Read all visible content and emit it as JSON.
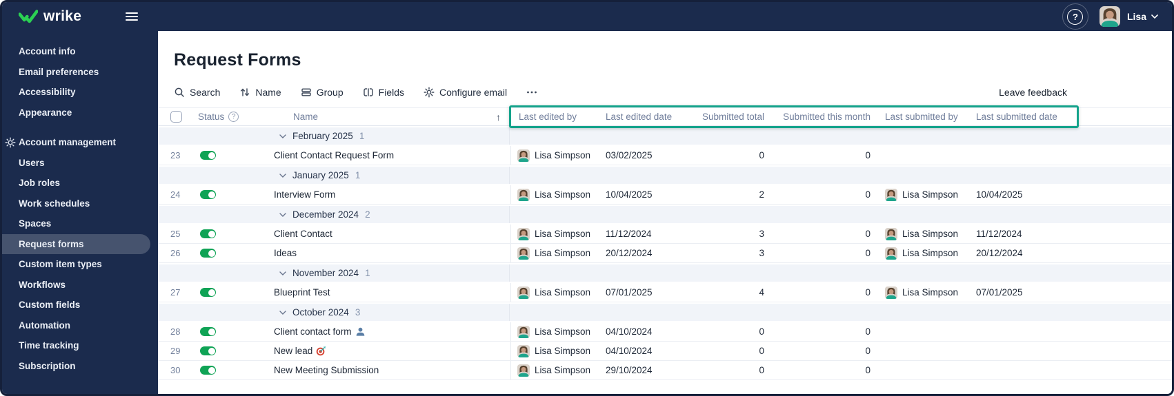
{
  "colors": {
    "navy": "#1B2B4D",
    "sidebar_selected": "#46536E",
    "toggle_green": "#0FA355",
    "annotation_green": "#14A38B",
    "group_row_bg": "#F1F4F9"
  },
  "topbar": {
    "logo_text": "wrike",
    "help_glyph": "?",
    "user_name": "Lisa"
  },
  "sidebar": {
    "items": [
      {
        "label": "Account info"
      },
      {
        "label": "Email preferences"
      },
      {
        "label": "Accessibility"
      },
      {
        "label": "Appearance"
      },
      {
        "label": "Account management",
        "section": true,
        "icon": "gear"
      },
      {
        "label": "Users"
      },
      {
        "label": "Job roles"
      },
      {
        "label": "Work schedules"
      },
      {
        "label": "Spaces"
      },
      {
        "label": "Request forms",
        "selected": true
      },
      {
        "label": "Custom item types"
      },
      {
        "label": "Workflows"
      },
      {
        "label": "Custom fields"
      },
      {
        "label": "Automation"
      },
      {
        "label": "Time tracking"
      },
      {
        "label": "Subscription"
      }
    ]
  },
  "main": {
    "title": "Request Forms",
    "toolbar": [
      {
        "label": "Search",
        "icon": "search"
      },
      {
        "label": "Name",
        "icon": "sort"
      },
      {
        "label": "Group",
        "icon": "group"
      },
      {
        "label": "Fields",
        "icon": "fields"
      },
      {
        "label": "Configure email",
        "icon": "gear"
      },
      {
        "label": "",
        "icon": "more"
      }
    ],
    "leave_feedback": "Leave feedback",
    "table": {
      "header": {
        "status": "Status",
        "status_help": "?",
        "name": "Name",
        "sort_arrow": "↑",
        "last_edited_by": "Last edited by",
        "last_edited_date": "Last edited date",
        "submitted_total": "Submitted total",
        "submitted_this_month": "Submitted this month",
        "last_submitted_by": "Last submitted by",
        "last_submitted_date": "Last submitted date"
      },
      "rows": [
        {
          "type": "group",
          "label": "February 2025",
          "count": "1"
        },
        {
          "type": "form",
          "num": "23",
          "enabled": true,
          "name": "Client Contact Request Form",
          "edited_by": "Lisa Simpson",
          "edited_date": "03/02/2025",
          "submitted_total": "0",
          "submitted_month": "0",
          "submitted_by": "",
          "submitted_date": ""
        },
        {
          "type": "group",
          "label": "January 2025",
          "count": "1"
        },
        {
          "type": "form",
          "num": "24",
          "enabled": true,
          "name": "Interview Form",
          "edited_by": "Lisa Simpson",
          "edited_date": "10/04/2025",
          "submitted_total": "2",
          "submitted_month": "0",
          "submitted_by": "Lisa Simpson",
          "submitted_date": "10/04/2025"
        },
        {
          "type": "group",
          "label": "December 2024",
          "count": "2"
        },
        {
          "type": "form",
          "num": "25",
          "enabled": true,
          "name": "Client Contact",
          "edited_by": "Lisa Simpson",
          "edited_date": "11/12/2024",
          "submitted_total": "3",
          "submitted_month": "0",
          "submitted_by": "Lisa Simpson",
          "submitted_date": "11/12/2024"
        },
        {
          "type": "form",
          "num": "26",
          "enabled": true,
          "name": "Ideas",
          "edited_by": "Lisa Simpson",
          "edited_date": "20/12/2024",
          "submitted_total": "3",
          "submitted_month": "0",
          "submitted_by": "Lisa Simpson",
          "submitted_date": "20/12/2024"
        },
        {
          "type": "group",
          "label": "November 2024",
          "count": "1"
        },
        {
          "type": "form",
          "num": "27",
          "enabled": true,
          "name": "Blueprint Test",
          "edited_by": "Lisa Simpson",
          "edited_date": "07/01/2025",
          "submitted_total": "4",
          "submitted_month": "0",
          "submitted_by": "Lisa Simpson",
          "submitted_date": "07/01/2025"
        },
        {
          "type": "group",
          "label": "October 2024",
          "count": "3"
        },
        {
          "type": "form",
          "num": "28",
          "enabled": true,
          "name": "Client contact form",
          "name_icon": "bust-silhouette",
          "edited_by": "Lisa Simpson",
          "edited_date": "04/10/2024",
          "submitted_total": "0",
          "submitted_month": "0",
          "submitted_by": "",
          "submitted_date": ""
        },
        {
          "type": "form",
          "num": "29",
          "enabled": true,
          "name": "New lead",
          "name_icon": "target",
          "edited_by": "Lisa Simpson",
          "edited_date": "04/10/2024",
          "submitted_total": "0",
          "submitted_month": "0",
          "submitted_by": "",
          "submitted_date": ""
        },
        {
          "type": "form",
          "num": "30",
          "enabled": true,
          "name": "New Meeting Submission",
          "edited_by": "Lisa Simpson",
          "edited_date": "29/10/2024",
          "submitted_total": "0",
          "submitted_month": "0",
          "submitted_by": "",
          "submitted_date": ""
        }
      ]
    }
  }
}
